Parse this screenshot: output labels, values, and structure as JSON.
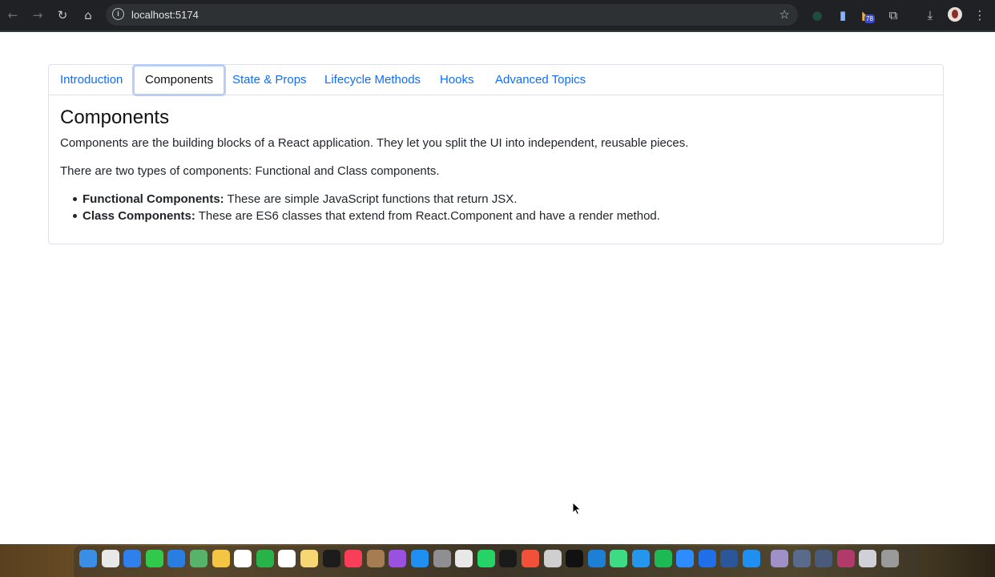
{
  "browser": {
    "url": "localhost:5174",
    "extension_badge": "78"
  },
  "tabs": [
    {
      "label": "Introduction",
      "active": false
    },
    {
      "label": "Components",
      "active": true
    },
    {
      "label": "State & Props",
      "active": false
    },
    {
      "label": "Lifecycle Methods",
      "active": false
    },
    {
      "label": "Hooks",
      "active": false
    },
    {
      "label": "Advanced Topics",
      "active": false
    }
  ],
  "content": {
    "heading": "Components",
    "paragraph1": "Components are the building blocks of a React application. They let you split the UI into independent, reusable pieces.",
    "paragraph2": "There are two types of components: Functional and Class components.",
    "items": [
      {
        "term": "Functional Components:",
        "text": " These are simple JavaScript functions that return JSX."
      },
      {
        "term": "Class Components:",
        "text": " These are ES6 classes that extend from React.Component and have a render method."
      }
    ]
  },
  "dock": {
    "calendar_month": "AUG",
    "calendar_day": "14",
    "apps": [
      "finder-icon",
      "launchpad-icon",
      "safari-icon",
      "messages-icon",
      "mail-icon",
      "maps-icon",
      "photos-icon",
      "calendar-icon",
      "facetime-icon",
      "reminders-icon",
      "notes-icon",
      "tv-icon",
      "music-icon",
      "finder-folder-icon",
      "podcasts-icon",
      "app-store-icon",
      "system-settings-icon",
      "chrome-icon",
      "whatsapp-icon",
      "terminal-icon",
      "swift-icon",
      "roblox-icon",
      "threads-icon",
      "vscode-icon",
      "android-studio-icon",
      "docker-icon",
      "spotify-icon",
      "zoom-icon",
      "tasks-icon",
      "word-icon",
      "keynote-icon",
      "screen-window-icon",
      "screen-window-icon",
      "screen-window-icon",
      "screen-window-icon",
      "screen-window-icon",
      "trash-icon"
    ]
  }
}
